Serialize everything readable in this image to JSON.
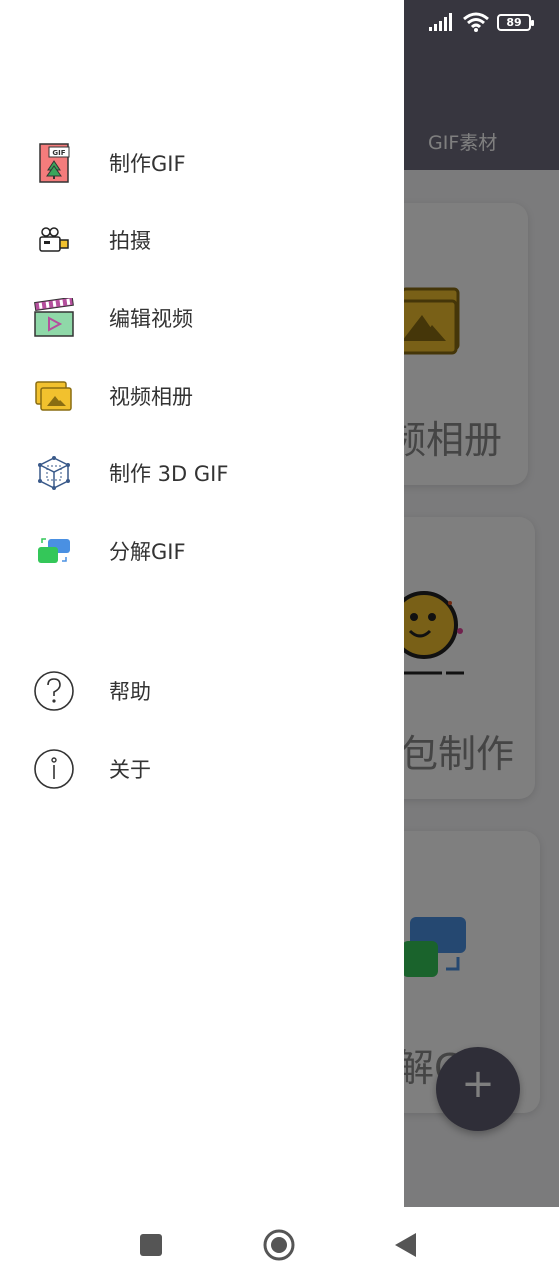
{
  "status_bar": {
    "battery": "89"
  },
  "background_app": {
    "tab_label": "GIF素材",
    "cards": [
      {
        "label": "视频相册",
        "visible_label": "频相册"
      },
      {
        "label": "表情包制作",
        "visible_label": "包制作"
      },
      {
        "label": "分解GIF",
        "visible_label": "解GIF"
      }
    ],
    "fab_label": "+"
  },
  "drawer": {
    "items": [
      {
        "label": "制作GIF",
        "icon": "gif-file-icon"
      },
      {
        "label": "拍摄",
        "icon": "video-camera-icon"
      },
      {
        "label": "编辑视频",
        "icon": "clapperboard-icon"
      },
      {
        "label": "视频相册",
        "icon": "photo-album-icon"
      },
      {
        "label": "制作 3D GIF",
        "icon": "cube-3d-icon"
      },
      {
        "label": "分解GIF",
        "icon": "split-gif-icon"
      }
    ],
    "secondary_items": [
      {
        "label": "帮助",
        "icon": "help-icon"
      },
      {
        "label": "关于",
        "icon": "info-icon"
      }
    ],
    "gif_badge": "GIF"
  },
  "colors": {
    "header": "#6e6c7e",
    "scrim": "rgba(0,0,0,0.5)",
    "accent_yellow": "#f2c12e",
    "accent_blue": "#4a90e2",
    "accent_green": "#34c759"
  }
}
